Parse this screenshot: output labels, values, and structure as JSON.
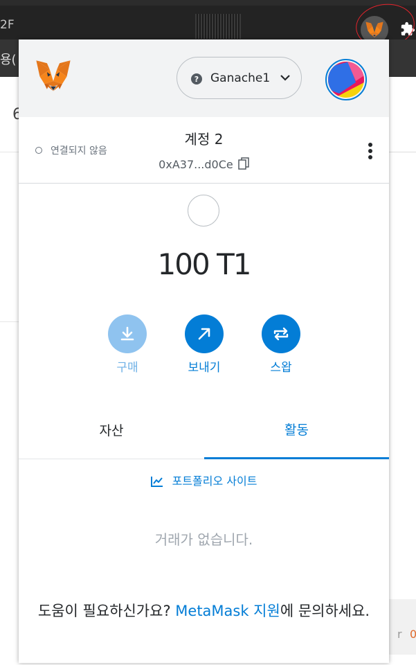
{
  "browser": {
    "left_text": "2F",
    "subbar_text": "용(",
    "page_glyph": "6",
    "bottom_right_a": "r",
    "bottom_right_b": "0"
  },
  "header": {
    "network_name": "Ganache1",
    "network_status_glyph": "?"
  },
  "account": {
    "connection_status": "연결되지 않음",
    "name": "계정 2",
    "address": "0xA37...d0Ce"
  },
  "balance": "100 T1",
  "actions": {
    "buy": "구매",
    "send": "보내기",
    "swap": "스왑"
  },
  "tabs": {
    "assets": "자산",
    "activity": "활동"
  },
  "portfolio_link": "포트폴리오 사이트",
  "empty_state": "거래가 없습니다.",
  "help": {
    "prefix": "도움이 필요하신가요? ",
    "link": "MetaMask 지원",
    "suffix": "에 문의하세요."
  },
  "colors": {
    "accent": "#037dd6",
    "buy_disabled": "#8fc3ef",
    "header_bg": "#f2f3f4",
    "annotation_red": "#e2232b"
  },
  "icons": {
    "logo": "metamask-fox-icon",
    "extension": "puzzle-icon",
    "buy": "download-icon",
    "send": "arrow-up-right-icon",
    "swap": "swap-arrows-icon",
    "copy": "copy-icon",
    "menu": "kebab-menu-icon",
    "portfolio": "chart-line-icon"
  }
}
